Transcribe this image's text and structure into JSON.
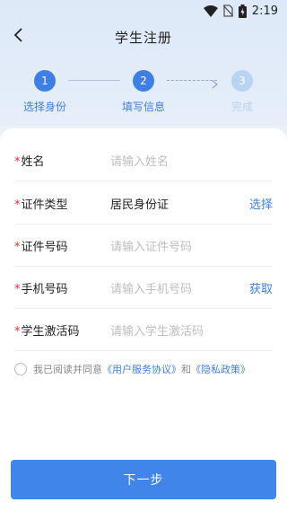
{
  "status_bar": {
    "time": "2:19"
  },
  "header": {
    "title": "学生注册"
  },
  "steps": [
    {
      "number": "1",
      "label": "选择身份",
      "state": "active"
    },
    {
      "number": "2",
      "label": "填写信息",
      "state": "active"
    },
    {
      "number": "3",
      "label": "完成",
      "state": "inactive"
    }
  ],
  "form": {
    "required_mark": "*",
    "name": {
      "label": "姓名",
      "placeholder": "请输入姓名"
    },
    "id_type": {
      "label": "证件类型",
      "value": "居民身份证",
      "action": "选择"
    },
    "id_number": {
      "label": "证件号码",
      "placeholder": "请输入证件号码"
    },
    "phone": {
      "label": "手机号码",
      "placeholder": "请输入手机号码",
      "action": "获取"
    },
    "activation_code": {
      "label": "学生激活码",
      "placeholder": "请输入学生激活码"
    }
  },
  "agreement": {
    "prefix": "我已阅读并同意",
    "service_link": "《用户服务协议》",
    "and": "和",
    "privacy_link": "《隐私政策》"
  },
  "footer": {
    "next_label": "下一步"
  },
  "colors": {
    "accent": "#3f7ee6",
    "required": "#e0302b",
    "step_inactive": "#b9d3f3"
  },
  "icons": [
    "wifi-icon",
    "no-sim-icon",
    "battery-icon",
    "back-arrow-icon",
    "arrow-right-icon"
  ]
}
